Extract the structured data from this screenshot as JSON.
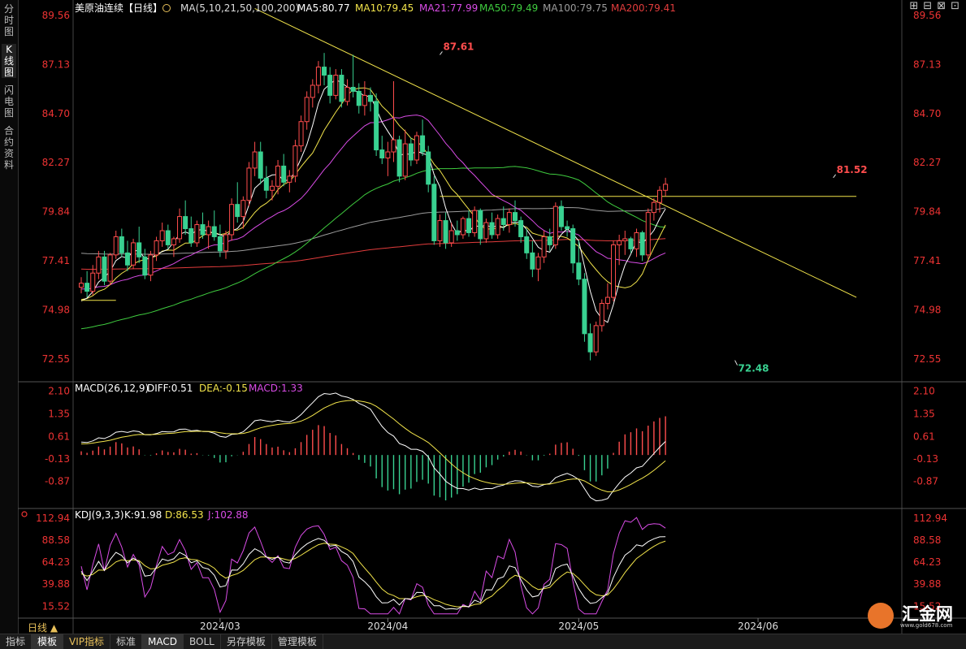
{
  "left_tabs": [
    "分时图",
    "K线图",
    "闪电图",
    "合约资料"
  ],
  "window_icons": [
    "⊞",
    "⊟",
    "⊠",
    "⊡"
  ],
  "bottom_tabs": [
    "指标",
    "模板",
    "VIP指标",
    "标准",
    "MACD",
    "BOLL",
    "另存模板",
    "管理模板"
  ],
  "period_label": "日线 ▲",
  "watermark": {
    "text": "汇金网",
    "url": "www.gold678.com"
  },
  "colors": {
    "up": "#ff4d4d",
    "down": "#39d191",
    "ma5": "#ffffff",
    "ma10": "#f2e44b",
    "ma21": "#d94ce6",
    "ma50": "#3fcc3f",
    "ma100": "#9b9b9b",
    "ma200": "#e23c3c",
    "diff": "#ffffff",
    "dea": "#f2e44b",
    "trend": "#f2e44b"
  },
  "chart_data": [
    {
      "type": "candlestick",
      "panel": "price",
      "title": "美原油连续【日线】",
      "ma_header": "MA(5,10,21,50,100,200)",
      "ma_labels": [
        "MA5:80.77",
        "MA10:79.45",
        "MA21:77.99",
        "MA50:79.49",
        "MA100:79.75",
        "MA200:79.41"
      ],
      "yticks": [
        "89.56",
        "87.13",
        "84.70",
        "82.27",
        "79.84",
        "77.41",
        "74.98",
        "72.55"
      ],
      "ylim": [
        71.5,
        90.0
      ],
      "xticks": [
        {
          "label": "2024/03",
          "index": 24
        },
        {
          "label": "2024/04",
          "index": 53
        },
        {
          "label": "2024/05",
          "index": 86
        },
        {
          "label": "2024/06",
          "index": 117
        }
      ],
      "annotations": [
        {
          "text": "87.61",
          "index": 62,
          "value": 87.61
        },
        {
          "text": "72.48",
          "index": 113,
          "value": 72.48
        },
        {
          "text": "81.52",
          "index": 130,
          "value": 81.52
        }
      ],
      "candles": [
        [
          76.1,
          76.6,
          75.8,
          76.3
        ],
        [
          76.3,
          76.9,
          75.6,
          75.9
        ],
        [
          75.9,
          77.2,
          75.7,
          76.8
        ],
        [
          76.8,
          77.9,
          76.5,
          77.6
        ],
        [
          77.6,
          77.9,
          76.2,
          76.4
        ],
        [
          76.4,
          77.8,
          76.2,
          77.7
        ],
        [
          77.7,
          78.9,
          77.5,
          78.6
        ],
        [
          78.6,
          79.0,
          77.6,
          77.8
        ],
        [
          77.8,
          78.4,
          76.9,
          77.2
        ],
        [
          77.2,
          78.5,
          77.0,
          78.3
        ],
        [
          78.3,
          79.1,
          77.3,
          77.6
        ],
        [
          77.6,
          78.0,
          76.5,
          76.7
        ],
        [
          76.7,
          77.9,
          76.4,
          77.7
        ],
        [
          77.7,
          78.6,
          77.4,
          78.4
        ],
        [
          78.4,
          79.3,
          78.1,
          78.9
        ],
        [
          78.9,
          79.2,
          78.0,
          78.2
        ],
        [
          78.2,
          78.6,
          77.6,
          78.5
        ],
        [
          78.5,
          80.0,
          78.3,
          79.6
        ],
        [
          79.6,
          80.4,
          78.7,
          79.0
        ],
        [
          79.0,
          79.6,
          78.1,
          78.3
        ],
        [
          78.3,
          79.4,
          78.1,
          79.2
        ],
        [
          79.2,
          79.8,
          78.5,
          78.7
        ],
        [
          78.7,
          79.4,
          78.0,
          79.1
        ],
        [
          79.1,
          79.9,
          78.4,
          78.6
        ],
        [
          78.6,
          79.2,
          77.6,
          77.9
        ],
        [
          77.9,
          78.9,
          77.5,
          78.7
        ],
        [
          78.7,
          80.5,
          78.4,
          80.2
        ],
        [
          80.2,
          81.3,
          79.3,
          79.6
        ],
        [
          79.6,
          80.6,
          79.0,
          80.4
        ],
        [
          80.4,
          82.3,
          80.1,
          82.0
        ],
        [
          82.0,
          83.3,
          81.6,
          82.8
        ],
        [
          82.8,
          83.3,
          81.2,
          81.5
        ],
        [
          81.5,
          82.1,
          80.5,
          80.9
        ],
        [
          80.9,
          81.4,
          80.4,
          81.1
        ],
        [
          81.1,
          82.4,
          80.7,
          82.1
        ],
        [
          82.1,
          82.7,
          81.1,
          81.3
        ],
        [
          81.3,
          81.9,
          80.8,
          81.6
        ],
        [
          81.6,
          83.4,
          81.3,
          83.1
        ],
        [
          83.1,
          84.6,
          82.8,
          84.3
        ],
        [
          84.3,
          85.8,
          83.9,
          85.5
        ],
        [
          85.5,
          86.4,
          85.0,
          86.1
        ],
        [
          86.1,
          87.3,
          85.7,
          87.0
        ],
        [
          87.0,
          87.7,
          86.1,
          86.6
        ],
        [
          86.6,
          87.0,
          85.2,
          85.6
        ],
        [
          85.6,
          86.9,
          85.4,
          86.6
        ],
        [
          86.6,
          86.9,
          85.0,
          85.3
        ],
        [
          85.3,
          86.4,
          85.1,
          86.0
        ],
        [
          86.0,
          87.61,
          85.5,
          85.8
        ],
        [
          85.8,
          86.2,
          84.7,
          85.1
        ],
        [
          85.1,
          86.3,
          84.6,
          85.6
        ],
        [
          85.6,
          86.0,
          84.8,
          85.3
        ],
        [
          85.3,
          85.7,
          82.6,
          82.9
        ],
        [
          82.9,
          83.6,
          82.2,
          82.5
        ],
        [
          82.5,
          83.3,
          81.6,
          82.8
        ],
        [
          82.8,
          86.3,
          82.3,
          83.4
        ],
        [
          83.4,
          83.6,
          81.3,
          81.6
        ],
        [
          81.6,
          83.9,
          81.4,
          83.2
        ],
        [
          83.2,
          83.5,
          82.1,
          82.4
        ],
        [
          82.4,
          83.8,
          82.2,
          83.6
        ],
        [
          83.6,
          84.4,
          82.6,
          82.8
        ],
        [
          82.8,
          83.1,
          80.8,
          81.2
        ],
        [
          81.2,
          81.6,
          78.2,
          78.4
        ],
        [
          78.4,
          79.7,
          78.1,
          79.4
        ],
        [
          79.4,
          79.8,
          78.0,
          78.3
        ],
        [
          78.3,
          79.3,
          78.1,
          78.9
        ],
        [
          78.9,
          79.4,
          78.4,
          78.7
        ],
        [
          78.7,
          79.6,
          78.5,
          79.5
        ],
        [
          79.5,
          79.9,
          78.6,
          78.8
        ],
        [
          78.8,
          80.1,
          78.6,
          79.9
        ],
        [
          79.9,
          80.0,
          78.2,
          78.5
        ],
        [
          78.5,
          79.5,
          78.3,
          79.3
        ],
        [
          79.3,
          79.8,
          78.5,
          78.7
        ],
        [
          78.7,
          79.7,
          78.5,
          79.5
        ],
        [
          79.5,
          80.1,
          78.9,
          79.2
        ],
        [
          79.2,
          80.0,
          78.8,
          79.8
        ],
        [
          79.8,
          80.4,
          79.1,
          79.4
        ],
        [
          79.4,
          79.6,
          78.3,
          78.6
        ],
        [
          78.6,
          79.0,
          77.5,
          77.8
        ],
        [
          77.8,
          78.4,
          76.6,
          77.0
        ],
        [
          77.0,
          77.8,
          76.4,
          77.6
        ],
        [
          77.6,
          78.9,
          77.3,
          78.6
        ],
        [
          78.6,
          79.0,
          77.9,
          78.2
        ],
        [
          78.2,
          80.3,
          78.0,
          80.1
        ],
        [
          80.1,
          80.4,
          78.9,
          79.1
        ],
        [
          79.1,
          79.4,
          78.6,
          79.0
        ],
        [
          79.0,
          79.2,
          76.8,
          77.3
        ],
        [
          77.3,
          78.4,
          76.2,
          76.5
        ],
        [
          76.5,
          76.8,
          73.4,
          73.8
        ],
        [
          73.8,
          74.3,
          72.48,
          72.9
        ],
        [
          72.9,
          74.4,
          72.7,
          74.2
        ],
        [
          74.2,
          75.5,
          73.9,
          75.3
        ],
        [
          75.3,
          76.3,
          75.0,
          75.6
        ],
        [
          75.6,
          78.4,
          75.4,
          78.2
        ],
        [
          78.2,
          78.7,
          77.2,
          78.4
        ],
        [
          78.4,
          78.9,
          77.7,
          78.5
        ],
        [
          78.5,
          78.6,
          77.8,
          78.0
        ],
        [
          78.0,
          79.0,
          77.6,
          78.8
        ],
        [
          78.8,
          78.9,
          77.4,
          77.7
        ],
        [
          77.7,
          80.0,
          77.5,
          79.8
        ],
        [
          79.8,
          80.5,
          79.4,
          80.3
        ],
        [
          80.3,
          81.1,
          79.8,
          80.9
        ],
        [
          80.9,
          81.52,
          80.6,
          81.2
        ]
      ],
      "horizontal_lines": [
        {
          "value": 75.45,
          "from_index": 0,
          "to_index": 6
        },
        {
          "value": 80.6,
          "from_index": 62,
          "to_index": 134
        }
      ],
      "trendline": {
        "from": {
          "index": 30,
          "value": 89.9
        },
        "to": {
          "index": 134,
          "value": 75.6
        }
      }
    },
    {
      "type": "macd",
      "panel": "macd",
      "title": "MACD(26,12,9)",
      "labels": [
        "DIFF:0.51",
        "DEA:-0.15",
        "MACD:1.33"
      ],
      "yticks": [
        "2.10",
        "1.35",
        "0.61",
        "-0.13",
        "-0.87"
      ],
      "ylim": [
        -1.6,
        2.25
      ]
    },
    {
      "type": "kdj",
      "panel": "kdj",
      "title": "KDJ(9,3,3)",
      "labels": [
        "K:91.98",
        "D:86.53",
        "J:102.88"
      ],
      "yticks": [
        "112.94",
        "88.58",
        "64.23",
        "39.88",
        "15.52"
      ],
      "ylim": [
        5,
        120
      ]
    }
  ]
}
